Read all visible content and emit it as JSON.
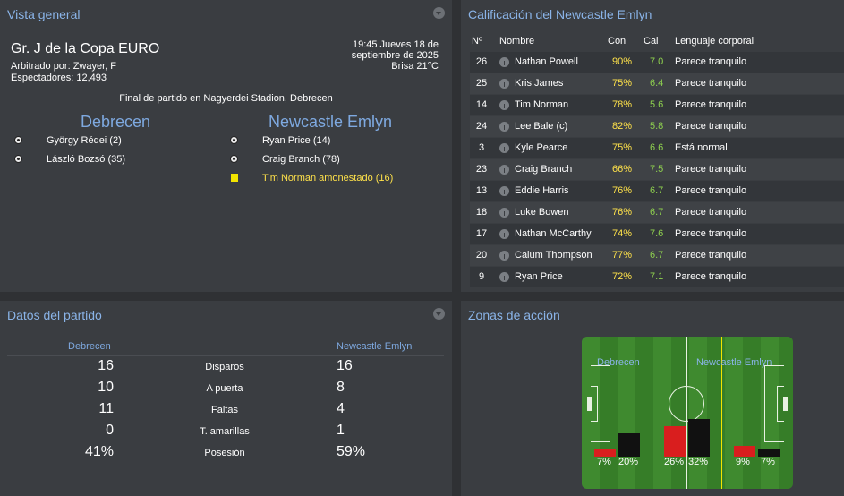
{
  "overview": {
    "title": "Vista general",
    "competition": "Gr. J de la Copa EURO",
    "referee": "Arbitrado por: Zwayer, F",
    "spectators": "Espectadores: 12,493",
    "datetime_line1": "19:45 Jueves 18 de",
    "datetime_line2": "septiembre de 2025",
    "weather": "Brisa 21°C",
    "venue": "Final de partido en Nagyerdei Stadion, Debrecen",
    "home_team": "Debrecen",
    "away_team": "Newcastle Emlyn",
    "home_events": [
      "György Rédei (2)",
      "László Bozsó (35)"
    ],
    "away_events": [
      "Ryan Price (14)",
      "Craig Branch (78)"
    ],
    "away_card": "Tim Norman amonestado (16)"
  },
  "ratings": {
    "title": "Calificación del Newcastle Emlyn",
    "headers": {
      "num": "Nº",
      "name": "Nombre",
      "con": "Con",
      "cal": "Cal",
      "body": "Lenguaje corporal"
    },
    "rows": [
      {
        "num": "26",
        "name": "Nathan Powell",
        "con": "90%",
        "cal": "7.0",
        "body": "Parece tranquilo"
      },
      {
        "num": "25",
        "name": "Kris James",
        "con": "75%",
        "cal": "6.4",
        "body": "Parece tranquilo"
      },
      {
        "num": "14",
        "name": "Tim Norman",
        "con": "78%",
        "cal": "5.6",
        "body": "Parece tranquilo"
      },
      {
        "num": "24",
        "name": "Lee Bale (c)",
        "con": "82%",
        "cal": "5.8",
        "body": "Parece tranquilo"
      },
      {
        "num": "3",
        "name": "Kyle Pearce",
        "con": "75%",
        "cal": "6.6",
        "body": "Está normal"
      },
      {
        "num": "23",
        "name": "Craig Branch",
        "con": "66%",
        "cal": "7.5",
        "body": "Parece tranquilo"
      },
      {
        "num": "13",
        "name": "Eddie Harris",
        "con": "76%",
        "cal": "6.7",
        "body": "Parece tranquilo"
      },
      {
        "num": "18",
        "name": "Luke Bowen",
        "con": "76%",
        "cal": "6.7",
        "body": "Parece tranquilo"
      },
      {
        "num": "17",
        "name": "Nathan McCarthy",
        "con": "74%",
        "cal": "7.6",
        "body": "Parece tranquilo"
      },
      {
        "num": "20",
        "name": "Calum Thompson",
        "con": "77%",
        "cal": "6.7",
        "body": "Parece tranquilo"
      },
      {
        "num": "9",
        "name": "Ryan Price",
        "con": "72%",
        "cal": "7.1",
        "body": "Parece tranquilo"
      }
    ]
  },
  "match": {
    "title": "Datos del partido",
    "home_team": "Debrecen",
    "away_team": "Newcastle Emlyn",
    "stats": [
      {
        "home": "16",
        "label": "Disparos",
        "away": "16"
      },
      {
        "home": "10",
        "label": "A puerta",
        "away": "8"
      },
      {
        "home": "11",
        "label": "Faltas",
        "away": "4"
      },
      {
        "home": "0",
        "label": "T. amarillas",
        "away": "1"
      },
      {
        "home": "41%",
        "label": "Posesión",
        "away": "59%"
      }
    ]
  },
  "zones": {
    "title": "Zonas de acción",
    "home_team": "Debrecen",
    "away_team": "Newcastle Emlyn",
    "home_color": "#d91e1e",
    "away_color": "#111111",
    "left_home": "7%",
    "left_away": "20%",
    "mid_home": "26%",
    "mid_away": "32%",
    "right_home": "9%",
    "right_away": "7%"
  }
}
